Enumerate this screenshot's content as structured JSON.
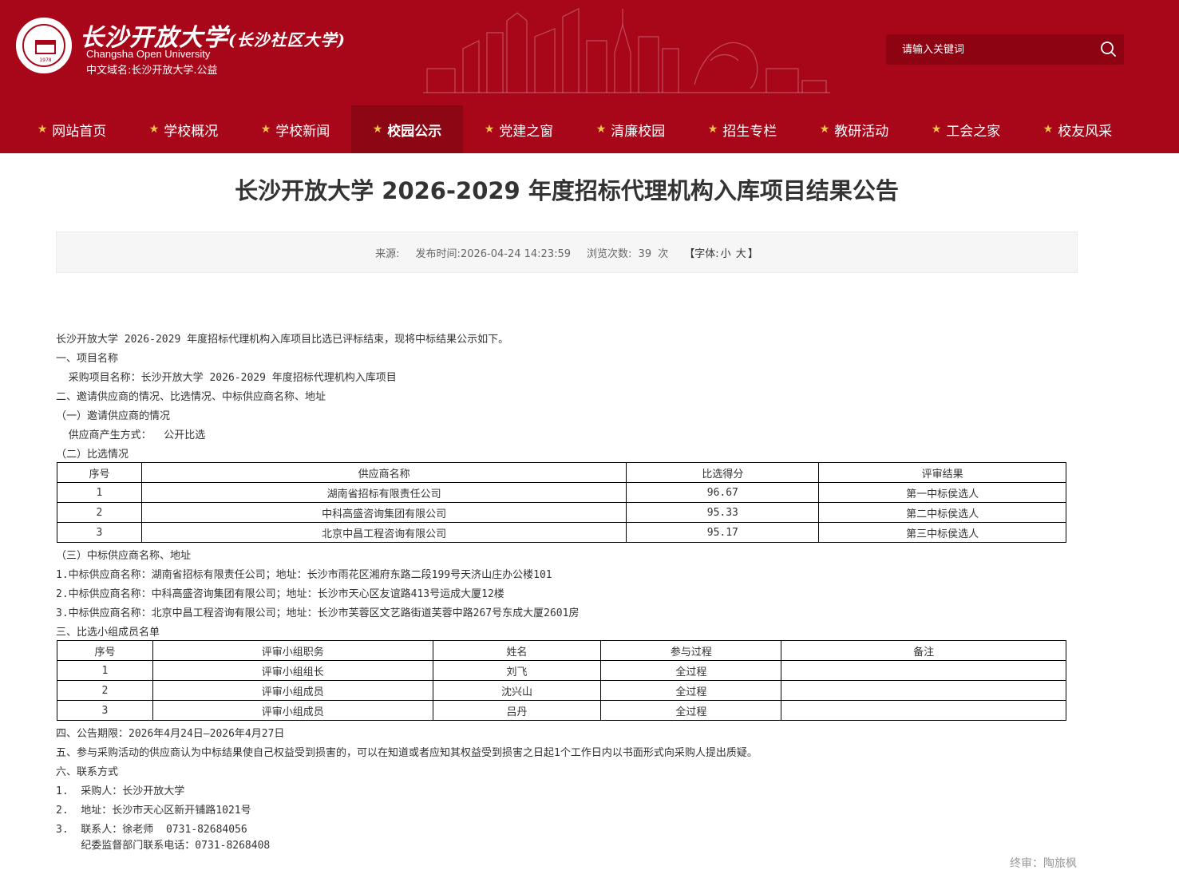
{
  "brand": {
    "name_cn": "长沙开放大学",
    "name_cn_sub": "(长沙社区大学)",
    "name_en": "Changsha Open University",
    "domain": "中文域名:长沙开放大学.公益",
    "logo_year": "1978"
  },
  "search": {
    "placeholder": "请输入关键词"
  },
  "nav": {
    "items": [
      {
        "label": "网站首页"
      },
      {
        "label": "学校概况"
      },
      {
        "label": "学校新闻"
      },
      {
        "label": "校园公示"
      },
      {
        "label": "党建之窗"
      },
      {
        "label": "清廉校园"
      },
      {
        "label": "招生专栏"
      },
      {
        "label": "教研活动"
      },
      {
        "label": "工会之家"
      },
      {
        "label": "校友风采"
      }
    ],
    "active_index": 3
  },
  "article": {
    "title": "长沙开放大学 2026-2029 年度招标代理机构入库项目结果公告",
    "meta": {
      "source_label": "来源:",
      "publish_label": "发布时间:",
      "publish_time": "2026-04-24 14:23:59",
      "views_label": "浏览次数:",
      "views": "39",
      "views_unit": "次",
      "font_open": "【字体:",
      "font_small": "小",
      "font_large": "大",
      "font_close": "】"
    },
    "intro": "长沙开放大学 2026-2029 年度招标代理机构入库项目比选已评标结束，现将中标结果公示如下。",
    "s1_heading": "一、项目名称",
    "s1_line": "  采购项目名称：长沙开放大学 2026-2029 年度招标代理机构入库项目",
    "s2_heading": "二、邀请供应商的情况、比选情况、中标供应商名称、地址",
    "s2a_heading": "（一）邀请供应商的情况",
    "s2a_line": "  供应商产生方式：  公开比选",
    "s2b_heading": "（二）比选情况",
    "bid_table": {
      "headers": [
        "序号",
        "供应商名称",
        "比选得分",
        "评审结果"
      ],
      "rows": [
        [
          "1",
          "湖南省招标有限责任公司",
          "96.67",
          "第一中标侯选人"
        ],
        [
          "2",
          "中科高盛咨询集团有限公司",
          "95.33",
          "第二中标侯选人"
        ],
        [
          "3",
          "北京中昌工程咨询有限公司",
          "95.17",
          "第三中标侯选人"
        ]
      ]
    },
    "s2c_heading": "（三）中标供应商名称、地址",
    "winners": [
      "1.中标供应商名称：湖南省招标有限责任公司；地址：长沙市雨花区湘府东路二段199号天济山庄办公楼101",
      "2.中标供应商名称：中科高盛咨询集团有限公司；地址：长沙市天心区友谊路413号运成大厦12楼",
      "3.中标供应商名称：北京中昌工程咨询有限公司；地址：长沙市芙蓉区文艺路街道芙蓉中路267号东成大厦2601房"
    ],
    "s3_heading": "三、比选小组成员名单",
    "panel_table": {
      "headers": [
        "序号",
        "评审小组职务",
        "姓名",
        "参与过程",
        "备注"
      ],
      "rows": [
        [
          "1",
          "评审小组组长",
          "刘飞",
          "全过程",
          ""
        ],
        [
          "2",
          "评审小组成员",
          "沈兴山",
          "全过程",
          ""
        ],
        [
          "3",
          "评审小组成员",
          "吕丹",
          "全过程",
          ""
        ]
      ]
    },
    "s4_line": "四、公告期限：2026年4月24日—2026年4月27日",
    "s5_line": "五、参与采购活动的供应商认为中标结果使自己权益受到损害的，可以在知道或者应知其权益受到损害之日起1个工作日内以书面形式向采购人提出质疑。",
    "s6_heading": "六、联系方式",
    "contacts": [
      "1.  采购人：长沙开放大学",
      "2.  地址：长沙市天心区新开铺路1021号",
      "3.  联系人：徐老师  0731-82684056",
      "    纪委监督部门联系电话：0731-8268408"
    ],
    "reviewer": "终审：陶旅枫"
  },
  "colors": {
    "header_bg": "#a8071a",
    "nav_active_bg": "#8d0613",
    "star": "#f7c24a"
  }
}
